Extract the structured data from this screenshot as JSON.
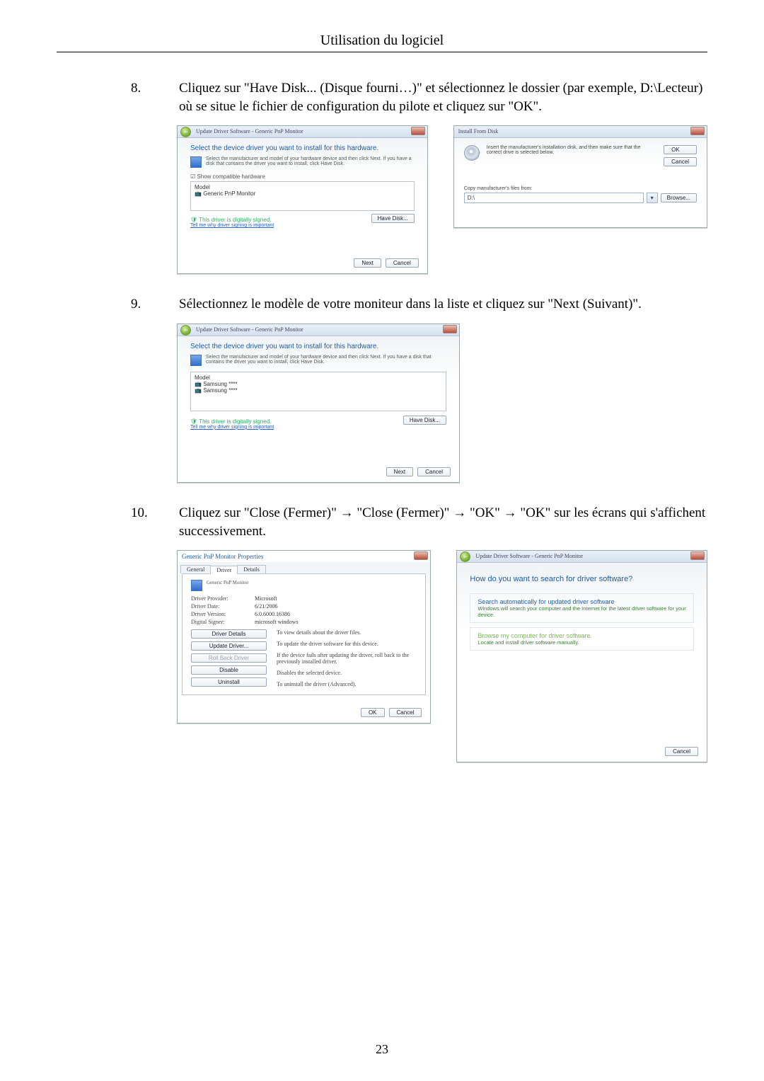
{
  "header": {
    "title": "Utilisation du logiciel"
  },
  "steps": {
    "s8": {
      "num": "8.",
      "text": "Cliquez sur \"Have Disk... (Disque fourni…)\" et sélectionnez le dossier (par exemple, D:\\Lecteur) où se situe le fichier de configuration du pilote et cliquez sur \"OK\"."
    },
    "s9": {
      "num": "9.",
      "text": "Sélectionnez le modèle de votre moniteur dans la liste et cliquez sur \"Next (Suivant)\"."
    },
    "s10": {
      "num": "10.",
      "text": "Cliquez sur \"Close (Fermer)\" → \"Close (Fermer)\" → \"OK\" → \"OK\" sur les écrans qui s'affichent successivement."
    }
  },
  "shot1": {
    "title": "Update Driver Software - Generic PnP Monitor",
    "heading": "Select the device driver you want to install for this hardware.",
    "hint": "Select the manufacturer and model of your hardware device and then click Next. If you have a disk that contains the driver you want to install, click Have Disk.",
    "show_compatible": "Show compatible hardware",
    "model_label": "Model",
    "model_item": "Generic PnP Monitor",
    "signed": "This driver is digitally signed.",
    "signed_link": "Tell me why driver signing is important",
    "have_disk": "Have Disk...",
    "next": "Next",
    "cancel": "Cancel"
  },
  "shot2": {
    "title": "Install From Disk",
    "hint": "Insert the manufacturer's installation disk, and then make sure that the correct drive is selected below.",
    "ok": "OK",
    "cancel": "Cancel",
    "copy_label": "Copy manufacturer's files from:",
    "path": "D:\\",
    "browse": "Browse..."
  },
  "shot3": {
    "title": "Update Driver Software - Generic PnP Monitor",
    "heading": "Select the device driver you want to install for this hardware.",
    "hint": "Select the manufacturer and model of your hardware device and then click Next. If you have a disk that contains the driver you want to install, click Have Disk.",
    "model_label": "Model",
    "item1": "Samsung ****",
    "item2": "Samsung ****",
    "signed": "This driver is digitally signed.",
    "signed_link": "Tell me why driver signing is important",
    "have_disk": "Have Disk...",
    "next": "Next",
    "cancel": "Cancel"
  },
  "shot4": {
    "title": "Generic PnP Monitor Properties",
    "tabs": {
      "general": "General",
      "driver": "Driver",
      "details": "Details"
    },
    "device": "Generic PnP Monitor",
    "kv": {
      "provider_k": "Driver Provider:",
      "provider_v": "Microsoft",
      "date_k": "Driver Date:",
      "date_v": "6/21/2006",
      "version_k": "Driver Version:",
      "version_v": "6.0.6000.16386",
      "signer_k": "Digital Signer:",
      "signer_v": "microsoft windows"
    },
    "btns": {
      "details": "Driver Details",
      "details_d": "To view details about the driver files.",
      "update": "Update Driver...",
      "update_d": "To update the driver software for this device.",
      "rollback": "Roll Back Driver",
      "rollback_d": "If the device fails after updating the driver, roll back to the previously installed driver.",
      "disable": "Disable",
      "disable_d": "Disables the selected device.",
      "uninstall": "Uninstall",
      "uninstall_d": "To uninstall the driver (Advanced)."
    },
    "ok": "OK",
    "cancel": "Cancel"
  },
  "shot5": {
    "title": "Update Driver Software - Generic PnP Monitor",
    "heading": "How do you want to search for driver software?",
    "opt1_t": "Search automatically for updated driver software",
    "opt1_d": "Windows will search your computer and the Internet for the latest driver software for your device.",
    "opt2_t": "Browse my computer for driver software",
    "opt2_d": "Locate and install driver software manually.",
    "cancel": "Cancel"
  },
  "page_number": "23"
}
